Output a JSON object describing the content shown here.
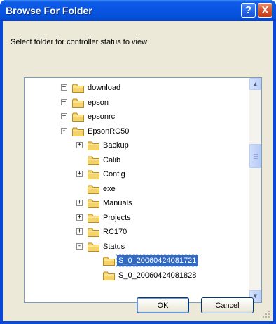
{
  "window": {
    "title": "Browse For Folder",
    "help_glyph": "?",
    "close_glyph": "X"
  },
  "dialog": {
    "description": "Select folder for controller status to view"
  },
  "tree": {
    "items": [
      {
        "label": "download",
        "expander": "+",
        "level": 0
      },
      {
        "label": "epson",
        "expander": "+",
        "level": 0
      },
      {
        "label": "epsonrc",
        "expander": "+",
        "level": 0
      },
      {
        "label": "EpsonRC50",
        "expander": "-",
        "level": 0
      },
      {
        "label": "Backup",
        "expander": "+",
        "level": 1
      },
      {
        "label": "Calib",
        "expander": "",
        "level": 1
      },
      {
        "label": "Config",
        "expander": "+",
        "level": 1
      },
      {
        "label": "exe",
        "expander": "",
        "level": 1
      },
      {
        "label": "Manuals",
        "expander": "+",
        "level": 1
      },
      {
        "label": "Projects",
        "expander": "+",
        "level": 1
      },
      {
        "label": "RC170",
        "expander": "+",
        "level": 1
      },
      {
        "label": "Status",
        "expander": "-",
        "level": 1
      },
      {
        "label": "S_0_20060424081721",
        "expander": "",
        "level": 2,
        "selected": true
      },
      {
        "label": "S_0_20060424081828",
        "expander": "",
        "level": 2
      }
    ]
  },
  "buttons": {
    "ok": "OK",
    "cancel": "Cancel"
  },
  "colors": {
    "titlebar": "#0854e0",
    "dialog_face": "#ece9d8",
    "selection": "#316ac5",
    "folder": "#f4d36a"
  }
}
